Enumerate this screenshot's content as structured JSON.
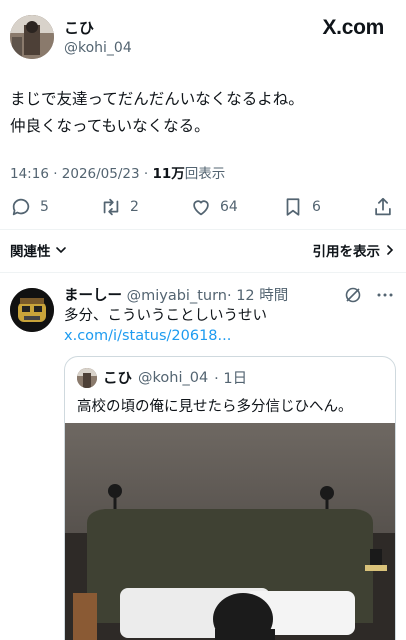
{
  "tweet": {
    "display_name": "こひ",
    "handle": "@kohi_04",
    "brand": "X.com",
    "body_lines": [
      "まじで友達ってだんだんいなくなるよね。",
      "仲良くなってもいなくなる。"
    ],
    "time": "14:16 · 2026/05/23 · ",
    "views_count": "11万",
    "views_label": "回表示",
    "actions": {
      "replies": "5",
      "retweets": "2",
      "likes": "64",
      "bookmarks": "6"
    },
    "related_label": "関連性",
    "quotes_label": "引用を表示"
  },
  "quote": {
    "display_name": "まーしー",
    "handle": "@miyabi_turn",
    "time": "· 12 時間",
    "text": "多分、こういうことしいうせい",
    "link": "x.com/i/status/20618...",
    "embed": {
      "display_name": "こひ",
      "handle": "@kohi_04",
      "time": "· 1日",
      "text": "高校の頃の俺に見せたら多分信じひへん。"
    }
  },
  "colors": {
    "text": "#0f1419",
    "secondary": "#536471",
    "link": "#1d9bf0",
    "border": "#cfd9de"
  }
}
